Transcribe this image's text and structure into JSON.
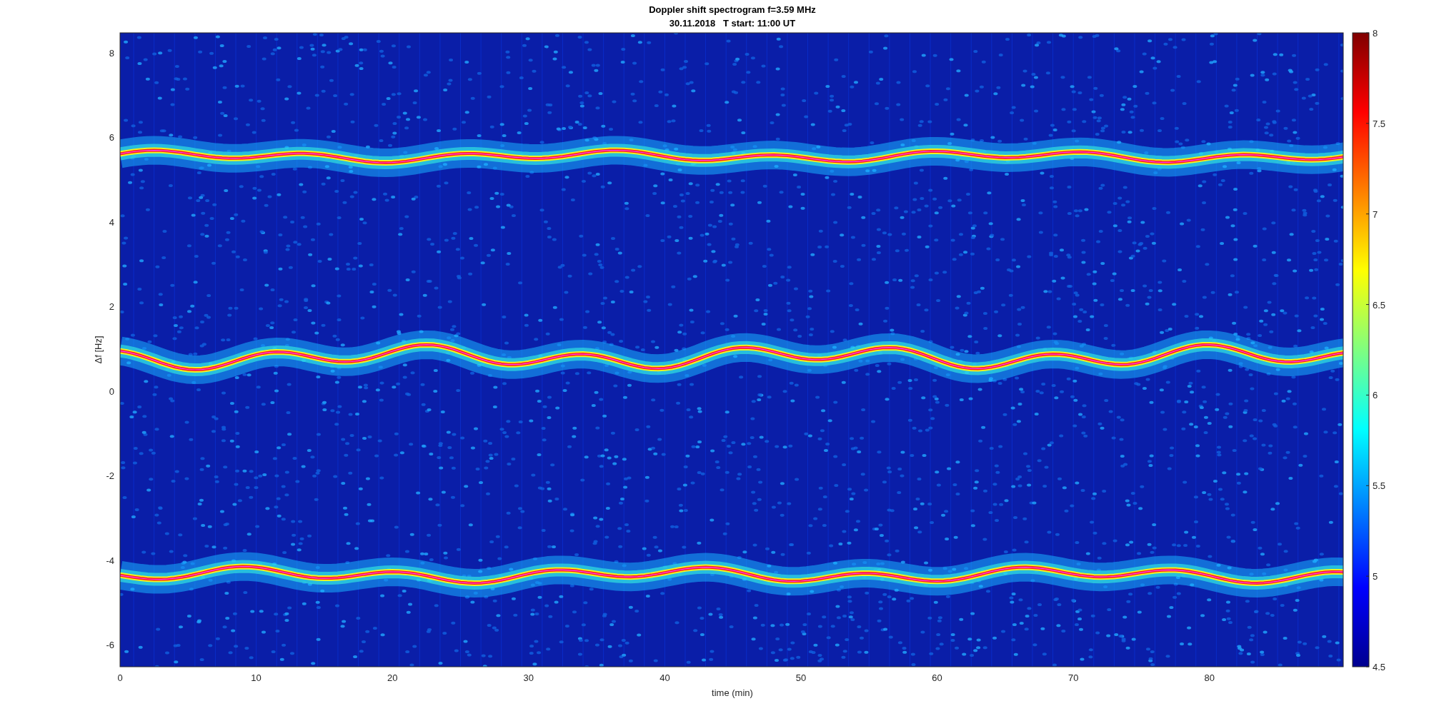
{
  "figure": {
    "title": "Doppler shift spectrogram f=3.59 MHz",
    "subtitle": "30.11.2018   T start: 11:00 UT"
  },
  "axes": {
    "xlabel": "time (min)",
    "ylabel": "Δf [Hz]",
    "xticks": [
      "0",
      "10",
      "20",
      "30",
      "40",
      "50",
      "60",
      "70",
      "80"
    ],
    "yticks": [
      "8",
      "6",
      "4",
      "2",
      "0",
      "-2",
      "-4",
      "-6"
    ]
  },
  "colorbar": {
    "ticks": [
      "8",
      "7.5",
      "7",
      "6.5",
      "6",
      "5.5",
      "5",
      "4.5"
    ]
  }
}
